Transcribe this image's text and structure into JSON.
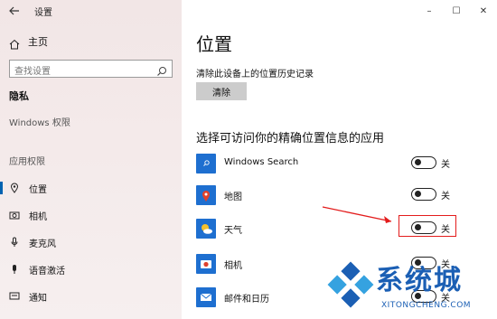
{
  "window": {
    "title": "设置",
    "controls": [
      "–",
      "☐",
      "✕"
    ]
  },
  "sidebar": {
    "home_label": "主页",
    "search_placeholder": "查找设置",
    "privacy_label": "隐私",
    "windows_perm_label": "Windows 权限",
    "app_perm_label": "应用权限",
    "items": [
      {
        "label": "位置",
        "icon": "location-icon",
        "selected": true
      },
      {
        "label": "相机",
        "icon": "camera-icon",
        "selected": false
      },
      {
        "label": "麦克风",
        "icon": "microphone-icon",
        "selected": false
      },
      {
        "label": "语音激活",
        "icon": "voice-activation-icon",
        "selected": false
      },
      {
        "label": "通知",
        "icon": "notification-icon",
        "selected": false
      }
    ]
  },
  "main": {
    "title": "位置",
    "clear_history_label": "清除此设备上的位置历史记录",
    "clear_button": "清除",
    "section_title": "选择可访问你的精确位置信息的应用",
    "apps": [
      {
        "name": "Windows Search",
        "state": "关",
        "on": false,
        "icon": "windows-search-icon",
        "color": "#1e6fd0"
      },
      {
        "name": "地图",
        "state": "关",
        "on": false,
        "icon": "maps-icon",
        "color": "#1e6fd0"
      },
      {
        "name": "天气",
        "state": "关",
        "on": false,
        "icon": "weather-icon",
        "color": "#1e6fd0"
      },
      {
        "name": "相机",
        "state": "关",
        "on": false,
        "icon": "camera-app-icon",
        "color": "#1e6fd0"
      },
      {
        "name": "邮件和日历",
        "state": "关",
        "on": false,
        "icon": "mail-calendar-icon",
        "color": "#1e6fd0"
      }
    ]
  },
  "watermark": {
    "text": "系统城",
    "sub": "XITONGCHENG.COM"
  },
  "colors": {
    "accent": "#0063b1",
    "annotation": "#e31c1c",
    "sidebar_bg": "#f2e6e6"
  }
}
